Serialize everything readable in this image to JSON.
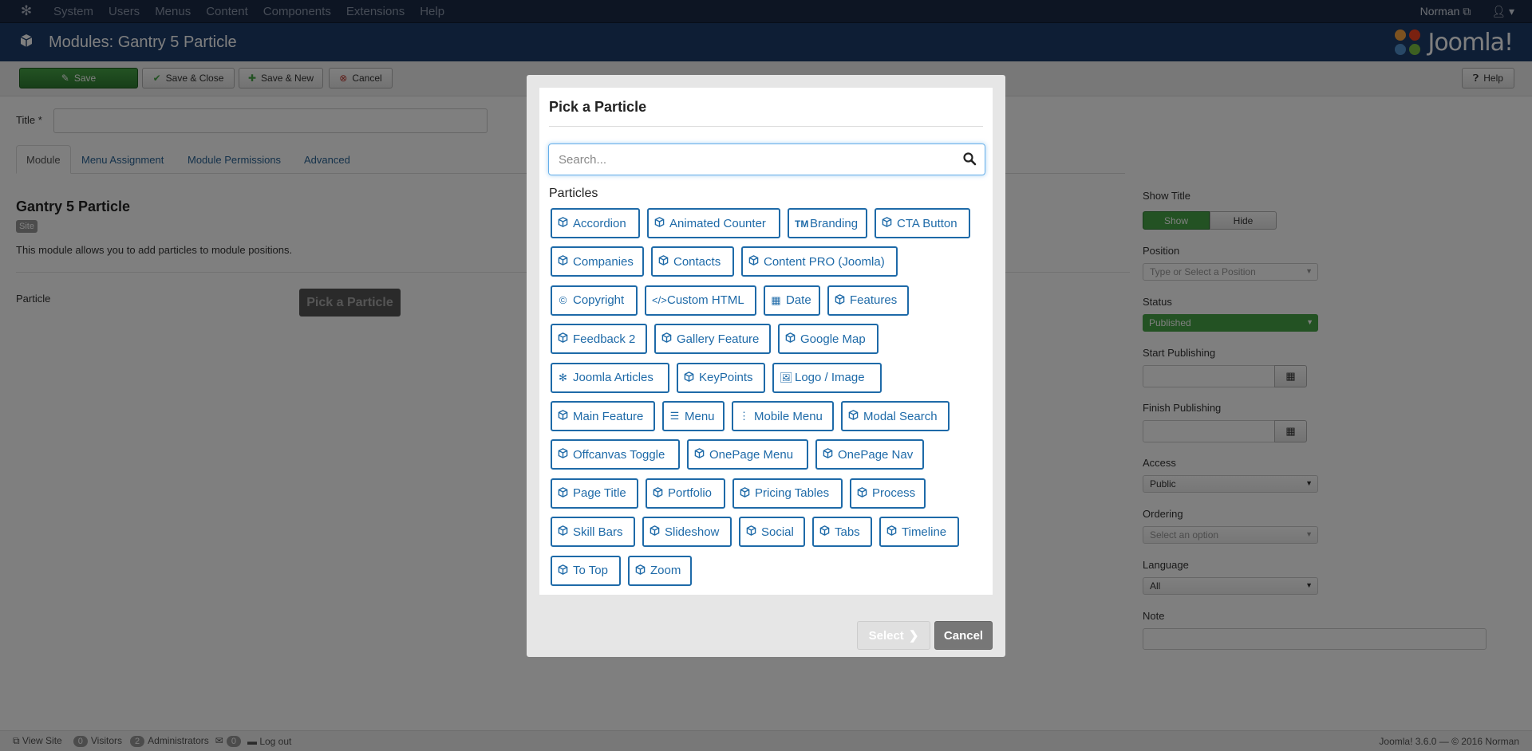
{
  "topbar": {
    "menu": [
      "System",
      "Users",
      "Menus",
      "Content",
      "Components",
      "Extensions",
      "Help"
    ],
    "user": "Norman"
  },
  "header": {
    "title": "Modules: Gantry 5 Particle",
    "brand": "Joomla!"
  },
  "toolbar": {
    "save": "Save",
    "save_close": "Save & Close",
    "save_new": "Save & New",
    "cancel": "Cancel",
    "help": "Help"
  },
  "form": {
    "title_label": "Title *",
    "tabs": [
      "Module",
      "Menu Assignment",
      "Module Permissions",
      "Advanced"
    ],
    "module_name": "Gantry 5 Particle",
    "site_badge": "Site",
    "description": "This module allows you to add particles to module positions.",
    "particle_label": "Particle",
    "pick_button": "Pick a Particle"
  },
  "sidebar": {
    "show_title_label": "Show Title",
    "show": "Show",
    "hide": "Hide",
    "position_label": "Position",
    "position_placeholder": "Type or Select a Position",
    "status_label": "Status",
    "status_value": "Published",
    "start_label": "Start Publishing",
    "finish_label": "Finish Publishing",
    "access_label": "Access",
    "access_value": "Public",
    "ordering_label": "Ordering",
    "ordering_value": "Select an option",
    "language_label": "Language",
    "language_value": "All",
    "note_label": "Note"
  },
  "modal": {
    "title": "Pick a Particle",
    "search_placeholder": "Search...",
    "section_label": "Particles",
    "select": "Select",
    "cancel": "Cancel",
    "particles": [
      {
        "label": "Accordion",
        "icon": "cube"
      },
      {
        "label": "Animated Counter",
        "icon": "cube"
      },
      {
        "label": "Branding",
        "icon": "trademark"
      },
      {
        "label": "CTA Button",
        "icon": "cube"
      },
      {
        "label": "Companies",
        "icon": "cube"
      },
      {
        "label": "Contacts",
        "icon": "cube"
      },
      {
        "label": "Content PRO (Joomla)",
        "icon": "cube"
      },
      {
        "label": "Copyright",
        "icon": "copyright"
      },
      {
        "label": "Custom HTML",
        "icon": "code"
      },
      {
        "label": "Date",
        "icon": "calendar"
      },
      {
        "label": "Features",
        "icon": "cube"
      },
      {
        "label": "Feedback 2",
        "icon": "cube"
      },
      {
        "label": "Gallery Feature",
        "icon": "cube"
      },
      {
        "label": "Google Map",
        "icon": "cube"
      },
      {
        "label": "Joomla Articles",
        "icon": "joomla"
      },
      {
        "label": "KeyPoints",
        "icon": "cube"
      },
      {
        "label": "Logo / Image",
        "icon": "image"
      },
      {
        "label": "Main Feature",
        "icon": "cube"
      },
      {
        "label": "Menu",
        "icon": "bars"
      },
      {
        "label": "Mobile Menu",
        "icon": "ellipsis"
      },
      {
        "label": "Modal Search",
        "icon": "cube"
      },
      {
        "label": "Offcanvas Toggle",
        "icon": "cube"
      },
      {
        "label": "OnePage Menu",
        "icon": "cube"
      },
      {
        "label": "OnePage Nav",
        "icon": "cube"
      },
      {
        "label": "Page Title",
        "icon": "cube"
      },
      {
        "label": "Portfolio",
        "icon": "cube"
      },
      {
        "label": "Pricing Tables",
        "icon": "cube"
      },
      {
        "label": "Process",
        "icon": "cube"
      },
      {
        "label": "Skill Bars",
        "icon": "cube"
      },
      {
        "label": "Slideshow",
        "icon": "cube"
      },
      {
        "label": "Social",
        "icon": "cube"
      },
      {
        "label": "Tabs",
        "icon": "cube"
      },
      {
        "label": "Timeline",
        "icon": "cube"
      },
      {
        "label": "To Top",
        "icon": "cube"
      },
      {
        "label": "Zoom",
        "icon": "cube"
      }
    ]
  },
  "statusbar": {
    "view_site": "View Site",
    "visitors_count": "0",
    "visitors": "Visitors",
    "admins_count": "2",
    "admins": "Administrators",
    "messages_count": "0",
    "logout": "Log out",
    "version": "Joomla! 3.6.0 — © 2016 Norman"
  },
  "colors": {
    "accent_blue": "#1e6aa8",
    "header_blue": "#1c3d6b",
    "topbar": "#1b2a47",
    "save_green": "#2f7d32"
  }
}
